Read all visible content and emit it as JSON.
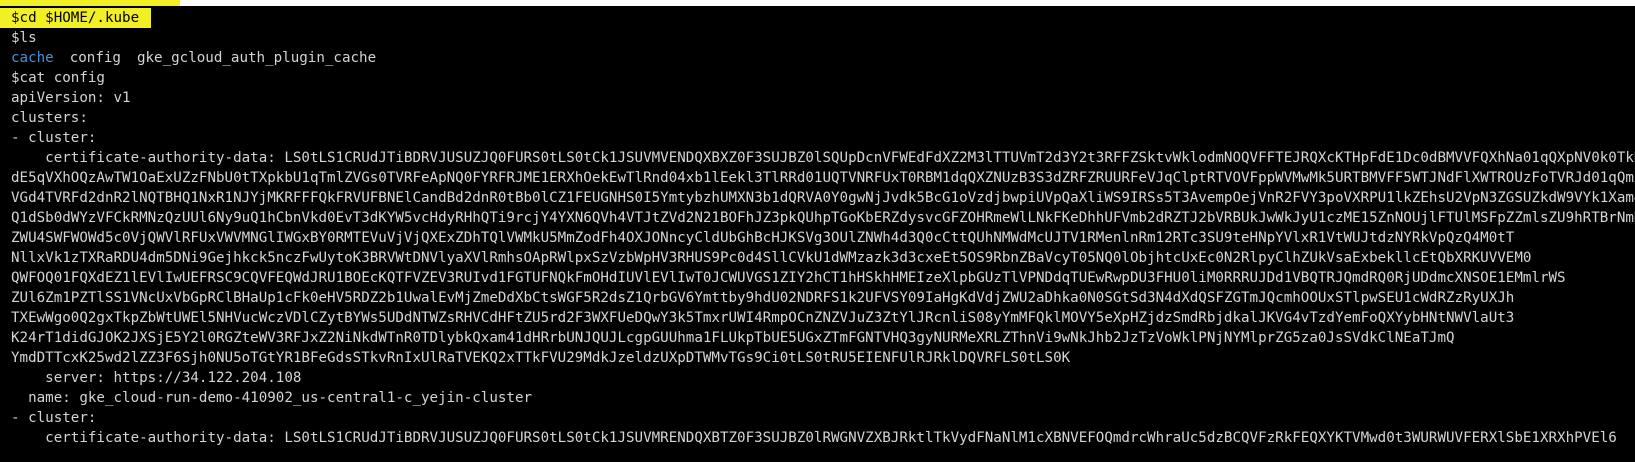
{
  "terminal": {
    "lines": [
      {
        "kind": "highlight",
        "text": "$cd $HOME/.kube"
      },
      {
        "kind": "plain",
        "text": "$ls"
      },
      {
        "kind": "ls",
        "dir": "cache",
        "files": [
          "config",
          "gke_gcloud_auth_plugin_cache"
        ]
      },
      {
        "kind": "plain",
        "text": "$cat config"
      },
      {
        "kind": "plain",
        "text": "apiVersion: v1"
      },
      {
        "kind": "plain",
        "text": "clusters:"
      },
      {
        "kind": "plain",
        "text": "- cluster:"
      },
      {
        "kind": "plain",
        "text": "    certificate-authority-data: LS0tLS1CRUdJTiBDRVJUSUZJQ0FURS0tLS0tCk1JSUVMVENDQXBXZ0F3SUJBZ0lSQUpDcnVFWEdFdXZ2M3lTTUVmT2d3Y2t3RFFZSktvWklodmNOQVFFTEJRQXcKTHpFdE1Dc0dBMVVFQXhNa01qQXpNV0k0TkRBdE5XTmxPQzAwTnpRMExXSmlNVE10WkRZMU1qYzROR0k0TlRBMwpNQjRYRFRJME1ERXdPRUV6TmpNeU1UWmFGdzB5TkRBeU1EY3hOak16TVRaYU1DOHhMVEFyQmdOVkJBTVRKREl3Ck16RmlPRFF3"
      },
      {
        "kind": "plain",
        "text": "dE5qVXhOQzAwTW1OaExUZzFNbU0tTXpkbU1qTmlZVGs0TVRFeApNQ0FYRFRJME1ERXhOekEwTlRnd04xb1lEekl3TlRRd01UQTVNRFUxT0RBM1dqQXZNUzB3S3dZRFZRUURFeVJqClptRTVOVFppWVMwMk5URTBMVFF5WTJNdFlXWTROUzFoTVRJd01qQmxOemcxTURJd0pCWW1LWlo1MnRNbFk="
      },
      {
        "kind": "plain",
        "text": "VGd4TVRFd2dnR2lNQTBHQ1NxR1NJYjMKRFFFQkFRVUFBNElCandBd2dnR0tBb0lCZ1FEUGNHS0I5YmtybzhUMXN3b1dQRVA0Y0gwNjJvdk5BcG1oVzdjbwpiUVpQaXliWS9IRSs5T3AvempOejVnR2FVY3poVXRPU1lkZEhsU2VpN3ZGSUZkdW9VYk1Xam4="
      },
      {
        "kind": "plain",
        "text": "Q1dSb0dWYzVFCkRMNzQzUUl6Ny9uQ1hCbnVkd0EvT3dKYW5vcHdyRHhQTi9rcjY4YXN6QVh4VTJtZVd2N21BOFhJZ3pkQUhpTGoKbERZdysvcGFZOHRmeWlLNkFKeDhhUFVmb2dRZTJ2bVRBUkJwWkJyU1czME15ZnNOUjlFTUlMSFpZZmlsZU9hRTBrNmRi"
      },
      {
        "kind": "plain",
        "text": "ZWU4SWFWOWd5c0VjQWVlRFUxVWVMNGlIWGxBY0RMTEVuVjVjQXExZDhTQlVWMkU5MmZodFh4OXJONncyCldUbGhBcHJKSVg3OUlZNWh4d3Q0cCttQUhNMWdMcUJTV1RMenlnRm12RTc3SU9teHNpYVlxR1VtWUJtdzNYRkVpQzQ4M0tT"
      },
      {
        "kind": "plain",
        "text": "NllxVk1zTXRaRDU4dm5DNi9Gejhkck5nczFwUytoK3BRVWtDNVlyaXVlRmhsOApRWlpxSzVzbWpHV3RHUS9Pc0d4SllCVkU1dWMzazk3d3cxeEt5OS9RbnZBaVcyT05NQ0lObjhtcUxEc0N2RlpyClhZUkVsaExbekllcEtQbXRKUVVEM0"
      },
      {
        "kind": "plain",
        "text": "QWFOQ01FQXdEZ1lEVlIwUEFRSC9CQVFEQWdJRU1BOEcKQTFVZEV3RUIvd1FGTUFNQkFmOHdIUVlEVlIwT0JCWUVGS1ZIY2hCT1hHSkhHMEIzeXlpbGUzTlVPNDdqTUEwRwpDU3FHU0liM0RRRUJDd1VBQTRJQmdRQ0RjUDdmcXNSOE1EMmlrWS"
      },
      {
        "kind": "plain",
        "text": "ZUl6Zm1PZTlSS1VNcUxVbGpRClBHaUp1cFk0eHV5RDZ2b1UwalEvMjZmeDdXbCtsWGF5R2dsZ1QrbGV6Ymttby9hdU02NDRFS1k2UFVSY09IaHgKdVdjZWU2aDhka0N0SGtSd3N4dXdQSFZGTmJQcmhOOUxSTlpwSEU1cWdRZzRyUXJh"
      },
      {
        "kind": "plain",
        "text": "TXEwWgo0Q2gxTkpZbWtUWEl5NHVucWczVDlCZytBYWs5UDdNTWZsRHVCdHFtZU5rd2F3WXFUeDQwY3k5TmxrUWI4RmpOCnZNZVJuZ3ZtYlJRcnliS08yYmMFQklMOVY5eXpHZjdzSmdRbjdkalJKVG4vTzdYemFoQXYybHNtNWVlaUt3"
      },
      {
        "kind": "plain",
        "text": "K24rT1didGJOK2JXSjE5Y2l0RGZteWV3RFJxZ2NiNkdWTnR0TDlybkQxam41dHRrbUNJQUJLcgpGUUhma1FLUkpTbUE5UGxZTmFGNTVHQ3gyNURMeXRLZThnVi9wNkJhb2JzTzVoWklPNjNYMlprZG5za0JsSVdkClNEaTJmQ"
      },
      {
        "kind": "plain",
        "text": "YmdDTTcxK25wd2lZZ3F6Sjh0NU5oTGtYR1BFeGdsSTkvRnIxUlRaTVEKQ2xTTkFVU29MdkJzeldzUXpDTWMvTGs9Ci0tLS0tRU5EIENFUlRJRklDQVRFLS0tLS0K"
      },
      {
        "kind": "plain",
        "text": "    server: https://34.122.204.108"
      },
      {
        "kind": "plain",
        "text": "  name: gke_cloud-run-demo-410902_us-central1-c_yejin-cluster"
      },
      {
        "kind": "plain",
        "text": "- cluster:"
      },
      {
        "kind": "plain",
        "text": "    certificate-authority-data: LS0tLS1CRUdJTiBDRVJUSUZJQ0FURS0tLS0tCk1JSUVMRENDQXBTZ0F3SUJBZ0lRWGNVZXBJRktlTkVydFNaNlM1cXBNVEFOQmdrcWhraUc5dzBCQVFzRkFEQXYKTVMwd0t3WURWUVFERXlSbE1XRXhPVEl6"
      }
    ]
  },
  "colors": {
    "highlight_bg": "#f2ef25",
    "terminal_bg": "#000000",
    "text": "#d4d4d4",
    "dir": "#4a90d9"
  }
}
